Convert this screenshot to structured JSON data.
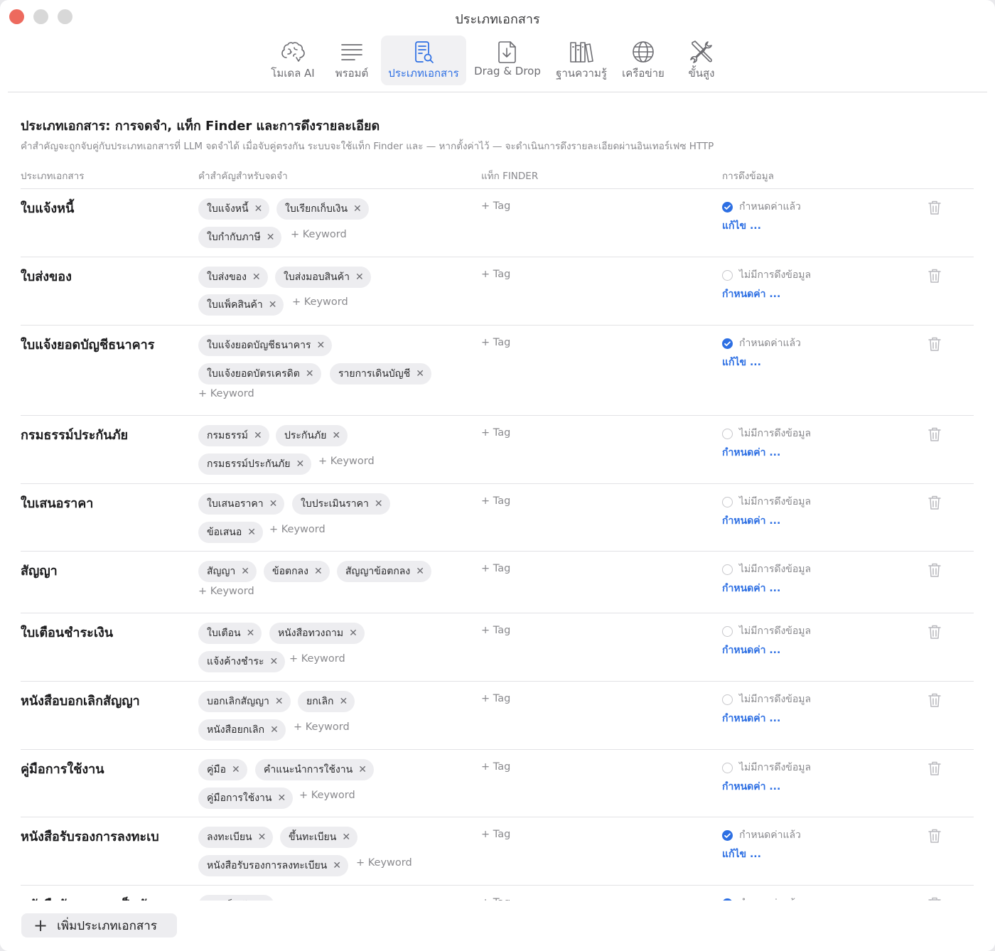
{
  "window": {
    "title": "ประเภทเอกสาร"
  },
  "toolbar": {
    "items": [
      {
        "label": "โมเดล AI",
        "icon": "brain-icon"
      },
      {
        "label": "พรอมต์",
        "icon": "text-lines-icon"
      },
      {
        "label": "ประเภทเอกสาร",
        "icon": "document-search-icon",
        "active": true
      },
      {
        "label": "Drag & Drop",
        "icon": "document-download-icon"
      },
      {
        "label": "ฐานความรู้",
        "icon": "books-icon"
      },
      {
        "label": "เครือข่าย",
        "icon": "globe-icon"
      },
      {
        "label": "ขั้นสูง",
        "icon": "tools-icon"
      }
    ]
  },
  "header": {
    "title": "ประเภทเอกสาร: การจดจำ, แท็ก Finder และการดึงรายละเอียด",
    "subtitle": "คำสำคัญจะถูกจับคู่กับประเภทเอกสารที่ LLM จดจำได้ เมื่อจับคู่ตรงกัน ระบบจะใช้แท็ก Finder และ — หากตั้งค่าไว้ — จะดำเนินการดึงรายละเอียดผ่านอินเทอร์เฟซ HTTP"
  },
  "columns": {
    "doc_type": "ประเภทเอกสาร",
    "keywords": "คำสำคัญสำหรับจดจำ",
    "finder_tags": "แท็ก FINDER",
    "extraction": "การดึงข้อมูล"
  },
  "labels": {
    "add_tag": "+ Tag",
    "add_keyword": "+ Keyword",
    "remove": "✕",
    "configured": "กำหนดค่าแล้ว",
    "not_configured": "ไม่มีการดึงข้อมูล",
    "edit": "แก้ไข ...",
    "configure": "กำหนดค่า ..."
  },
  "rows": [
    {
      "name": "ใบแจ้งหนี้",
      "keywords": [
        "ใบแจ้งหนี้",
        "ใบเรียกเก็บเงิน",
        "ใบกำกับภาษี"
      ],
      "configured": true
    },
    {
      "name": "ใบส่งของ",
      "keywords": [
        "ใบส่งของ",
        "ใบส่งมอบสินค้า",
        "ใบแพ็คสินค้า"
      ],
      "configured": false
    },
    {
      "name": "ใบแจ้งยอดบัญชีธนาคาร",
      "keywords": [
        "ใบแจ้งยอดบัญชีธนาคาร",
        "ใบแจ้งยอดบัตรเครดิต",
        "รายการเดินบัญชี"
      ],
      "configured": true
    },
    {
      "name": "กรมธรรม์ประกันภัย",
      "keywords": [
        "กรมธรรม์",
        "ประกันภัย",
        "กรมธรรม์ประกันภัย"
      ],
      "configured": false
    },
    {
      "name": "ใบเสนอราคา",
      "keywords": [
        "ใบเสนอราคา",
        "ใบประเมินราคา",
        "ข้อเสนอ"
      ],
      "configured": false
    },
    {
      "name": "สัญญา",
      "keywords": [
        "สัญญา",
        "ข้อตกลง",
        "สัญญาข้อตกลง"
      ],
      "configured": false
    },
    {
      "name": "ใบเตือนชำระเงิน",
      "keywords": [
        "ใบเตือน",
        "หนังสือทวงถาม",
        "แจ้งค้างชำระ"
      ],
      "configured": false
    },
    {
      "name": "หนังสือบอกเลิกสัญญา",
      "keywords": [
        "บอกเลิกสัญญา",
        "ยกเลิก",
        "หนังสือยกเลิก"
      ],
      "configured": false
    },
    {
      "name": "คู่มือการใช้งาน",
      "keywords": [
        "คู่มือ",
        "คำแนะนำการใช้งาน",
        "คู่มือการใช้งาน"
      ],
      "configured": false
    },
    {
      "name": "หนังสือรับรองการลงทะเบ",
      "keywords": [
        "ลงทะเบียน",
        "ขึ้นทะเบียน",
        "หนังสือรับรองการลงทะเบียน"
      ],
      "configured": true
    },
    {
      "name": "หนังสือรับรองการเป็นนัก",
      "keywords": [
        "การเป็นนัก"
      ],
      "configured": true
    }
  ],
  "footer": {
    "add_label": "เพิ่มประเภทเอกสาร"
  },
  "colors": {
    "accent": "#2d6fe3",
    "close": "#ed6a5e"
  }
}
